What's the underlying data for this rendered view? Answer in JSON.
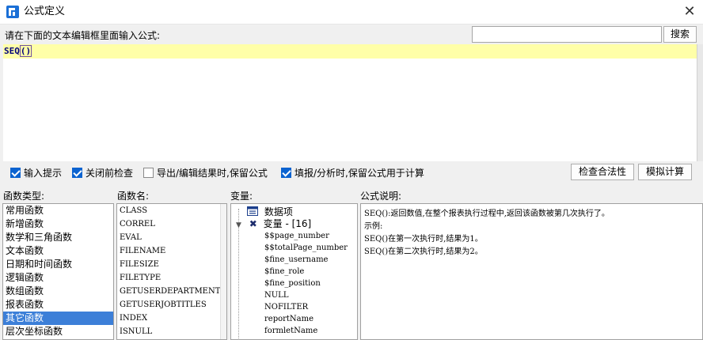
{
  "window": {
    "title": "公式定义"
  },
  "prompt": "请在下面的文本编辑框里面输入公式:",
  "search": {
    "value": "",
    "button": "搜索"
  },
  "editor": {
    "formula": "SEQ()"
  },
  "options": [
    {
      "label": "输入提示",
      "checked": true
    },
    {
      "label": "关闭前检查",
      "checked": true
    },
    {
      "label": "导出/编辑结果时,保留公式",
      "checked": false
    },
    {
      "label": "填报/分析时,保留公式用于计算",
      "checked": true
    }
  ],
  "buttons": {
    "check": "检查合法性",
    "simulate": "模拟计算"
  },
  "headers": {
    "categories": "函数类型:",
    "functions": "函数名:",
    "variables": "变量:",
    "description": "公式说明:"
  },
  "categories": [
    "常用函数",
    "新增函数",
    "数学和三角函数",
    "文本函数",
    "日期和时间函数",
    "逻辑函数",
    "数组函数",
    "报表函数",
    "其它函数",
    "层次坐标函数"
  ],
  "selected_category": "其它函数",
  "functions": [
    "CLASS",
    "CORREL",
    "EVAL",
    "FILENAME",
    "FILESIZE",
    "FILETYPE",
    "GETUSERDEPARTMENTS",
    "GETUSERJOBTITLES",
    "INDEX",
    "ISNULL"
  ],
  "variables": {
    "data_item": "数据项",
    "var_group": "变量 - [16]",
    "items": [
      "$$page_number",
      "$$totalPage_number",
      "$fine_username",
      "$fine_role",
      "$fine_position",
      "NULL",
      "NOFILTER",
      "reportName",
      "formletName"
    ]
  },
  "description": [
    "SEQ():返回数值,在整个报表执行过程中,返回该函数被第几次执行了。",
    "示例:",
    "SEQ()在第一次执行时,结果为1。",
    "SEQ()在第二次执行时,结果为2。"
  ],
  "colors": {
    "selection": "#3c7fd8",
    "checkbox": "#0b63d0",
    "highlight_line": "#ffffa8"
  }
}
